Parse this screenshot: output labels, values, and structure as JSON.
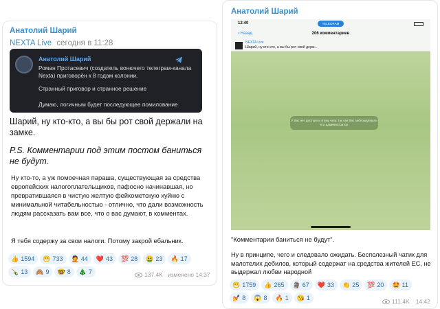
{
  "left_post": {
    "author": "Анатолий Шарий",
    "forwarded_from": "NEXTA Live",
    "forwarded_time": "сегодня в 11:28",
    "embed": {
      "author": "Анатолий Шарий",
      "line1": "Роман Протасевич (создатель вонючего телеграм-канала Nexta) приговорён к 8 годам колонии.",
      "line2": "Странный приговор и странное решение",
      "line3": "Думаю, логичным будет последующее помилование"
    },
    "main_text": "Шарий, ну кто-кто, а вы бы рот свой держали на замке.",
    "ps_text": "P.S. Комментарии под этим постом баниться не будут.",
    "comment": "Ну кто-то, а уж помоечная параша, существующая за средства европейских налогоплательщиков, пафосно начинавшая, но превратившаяся в чистую желтую фейкометскую хуйню с минимальной читабельностью - отлично, что дали возможность людям рассказать вам все, что о вас думают, в комментах.",
    "comment2": "Я тебя содержу за свои налоги. Потому закрой ебальник.",
    "reactions": [
      {
        "emoji": "👍",
        "count": "1594"
      },
      {
        "emoji": "😁",
        "count": "733"
      },
      {
        "emoji": "🤦",
        "count": "44"
      },
      {
        "emoji": "❤️",
        "count": "43"
      },
      {
        "emoji": "💯",
        "count": "28"
      },
      {
        "emoji": "🤮",
        "count": "23"
      },
      {
        "emoji": "🔥",
        "count": "17"
      },
      {
        "emoji": "🍾",
        "count": "13"
      },
      {
        "emoji": "🙈",
        "count": "9"
      },
      {
        "emoji": "🤓",
        "count": "8"
      },
      {
        "emoji": "🎄",
        "count": "7"
      }
    ],
    "views": "137.4K",
    "edited": "изменено 14:37"
  },
  "right_post": {
    "author": "Анатолий Шарий",
    "phone": {
      "time": "12:40",
      "pill": "TELEGRAM",
      "back": "Назад",
      "title": "206 комментариев",
      "pin_name": "NEXTA Live",
      "pin_text": "Шарий, ну кто-кто, а вы бы рот свой держ...",
      "notice": "У Вас нет доступа к этому чату, так как Вас заблокировали его администратор"
    },
    "quote": "\"Комментарии баниться не будут\".",
    "comment": "Ну в принципе, чего и следовало ожидать. Бесполезный чатик для малотелих дебилов, который содержат на средства жителей ЕС, не выдержал любви народной",
    "reactions": [
      {
        "emoji": "😁",
        "count": "1759"
      },
      {
        "emoji": "👍",
        "count": "265"
      },
      {
        "emoji": "🗿",
        "count": "67"
      },
      {
        "emoji": "❤️",
        "count": "33"
      },
      {
        "emoji": "👏",
        "count": "25"
      },
      {
        "emoji": "💯",
        "count": "20"
      },
      {
        "emoji": "🤩",
        "count": "11"
      },
      {
        "emoji": "💅",
        "count": "8"
      },
      {
        "emoji": "😱",
        "count": "8"
      },
      {
        "emoji": "🔥",
        "count": "1"
      },
      {
        "emoji": "😘",
        "count": "1"
      }
    ],
    "views": "111.4K",
    "time": "14:42"
  }
}
